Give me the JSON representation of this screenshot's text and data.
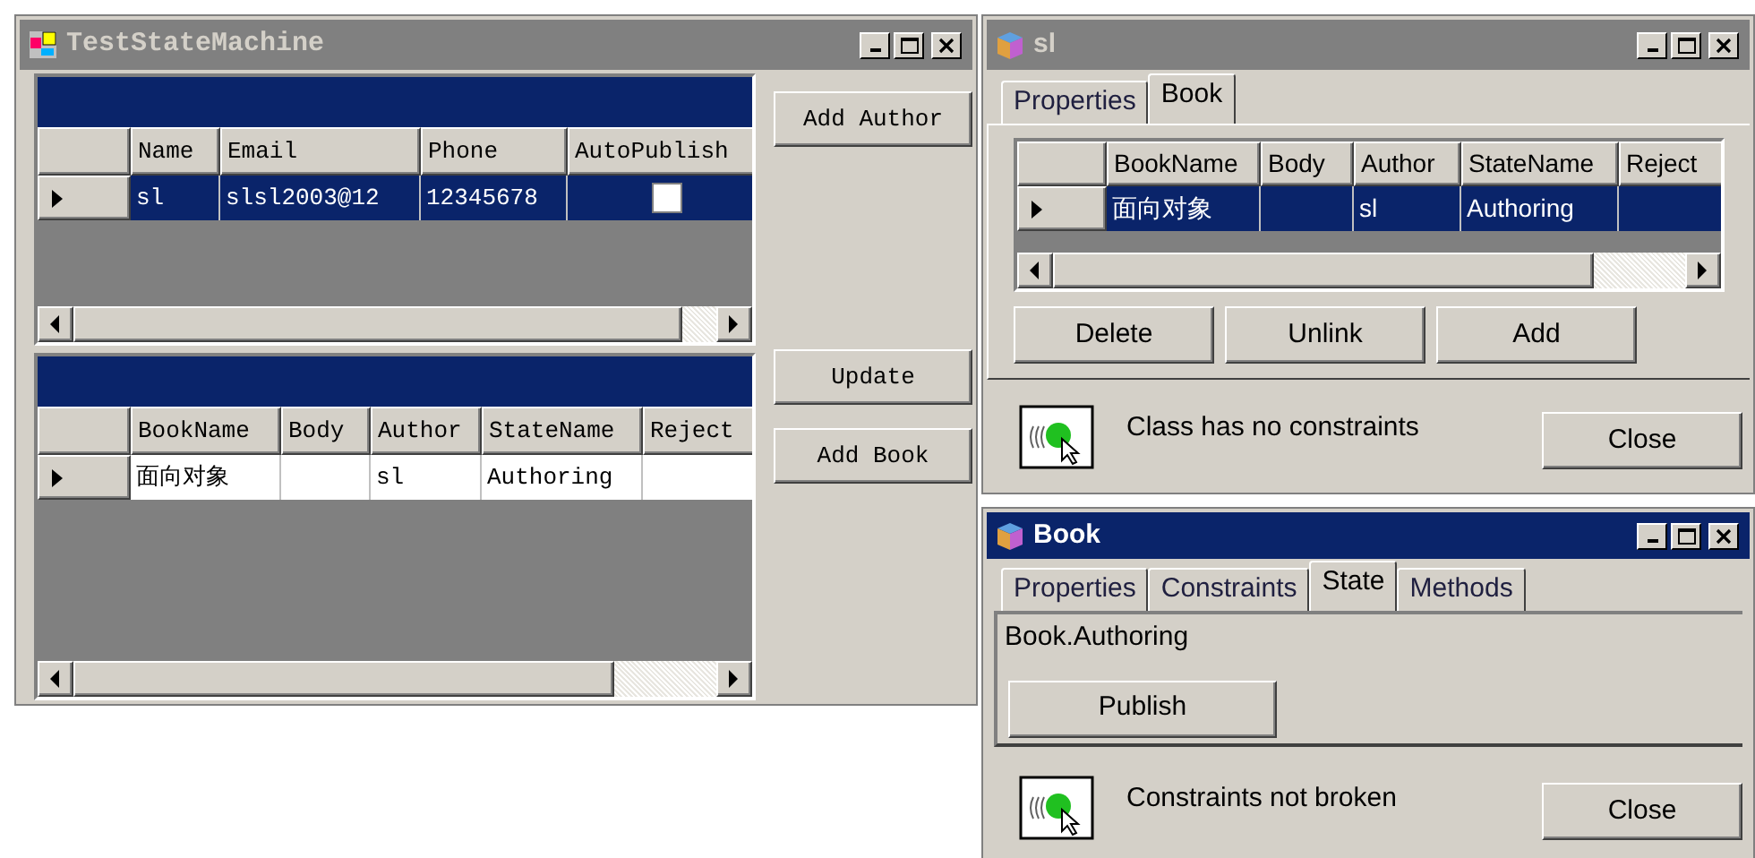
{
  "main_window": {
    "title": "TestStateMachine",
    "active": false,
    "author_grid": {
      "columns": [
        "Name",
        "Email",
        "Phone",
        "AutoPublish"
      ],
      "rows": [
        {
          "selected": true,
          "cells": [
            "sl",
            "slsl2003@12",
            "12345678"
          ],
          "auto_publish": {
            "checked": false
          }
        }
      ]
    },
    "book_grid": {
      "columns": [
        "BookName",
        "Body",
        "Author",
        "StateName",
        "Reject"
      ],
      "rows": [
        {
          "selected": false,
          "cells": [
            "面向对象",
            null,
            "sl",
            "Authoring",
            null
          ]
        }
      ]
    },
    "buttons": [
      "Add Author",
      "Update",
      "Add Book"
    ]
  },
  "author_window": {
    "title": "sl",
    "active": false,
    "tabs": [
      {
        "label": "Properties",
        "selected": false
      },
      {
        "label": "Book",
        "selected": true
      }
    ],
    "grid": {
      "columns": [
        "BookName",
        "Body",
        "Author",
        "StateName",
        "Reject"
      ],
      "rows": [
        {
          "selected": true,
          "cells": [
            "面向对象",
            null,
            "sl",
            "Authoring",
            null
          ]
        }
      ]
    },
    "buttons": [
      "Delete",
      "Unlink",
      "Add"
    ],
    "status": "Class has no constraints",
    "close_button": "Close"
  },
  "book_window": {
    "title": "Book",
    "active": true,
    "tabs": [
      {
        "label": "Properties",
        "selected": false
      },
      {
        "label": "Constraints",
        "selected": false
      },
      {
        "label": "State",
        "selected": true
      },
      {
        "label": "Methods",
        "selected": false
      }
    ],
    "state": "Book.Authoring",
    "action_button": "Publish",
    "status": "Constraints not broken",
    "close_button": "Close"
  }
}
